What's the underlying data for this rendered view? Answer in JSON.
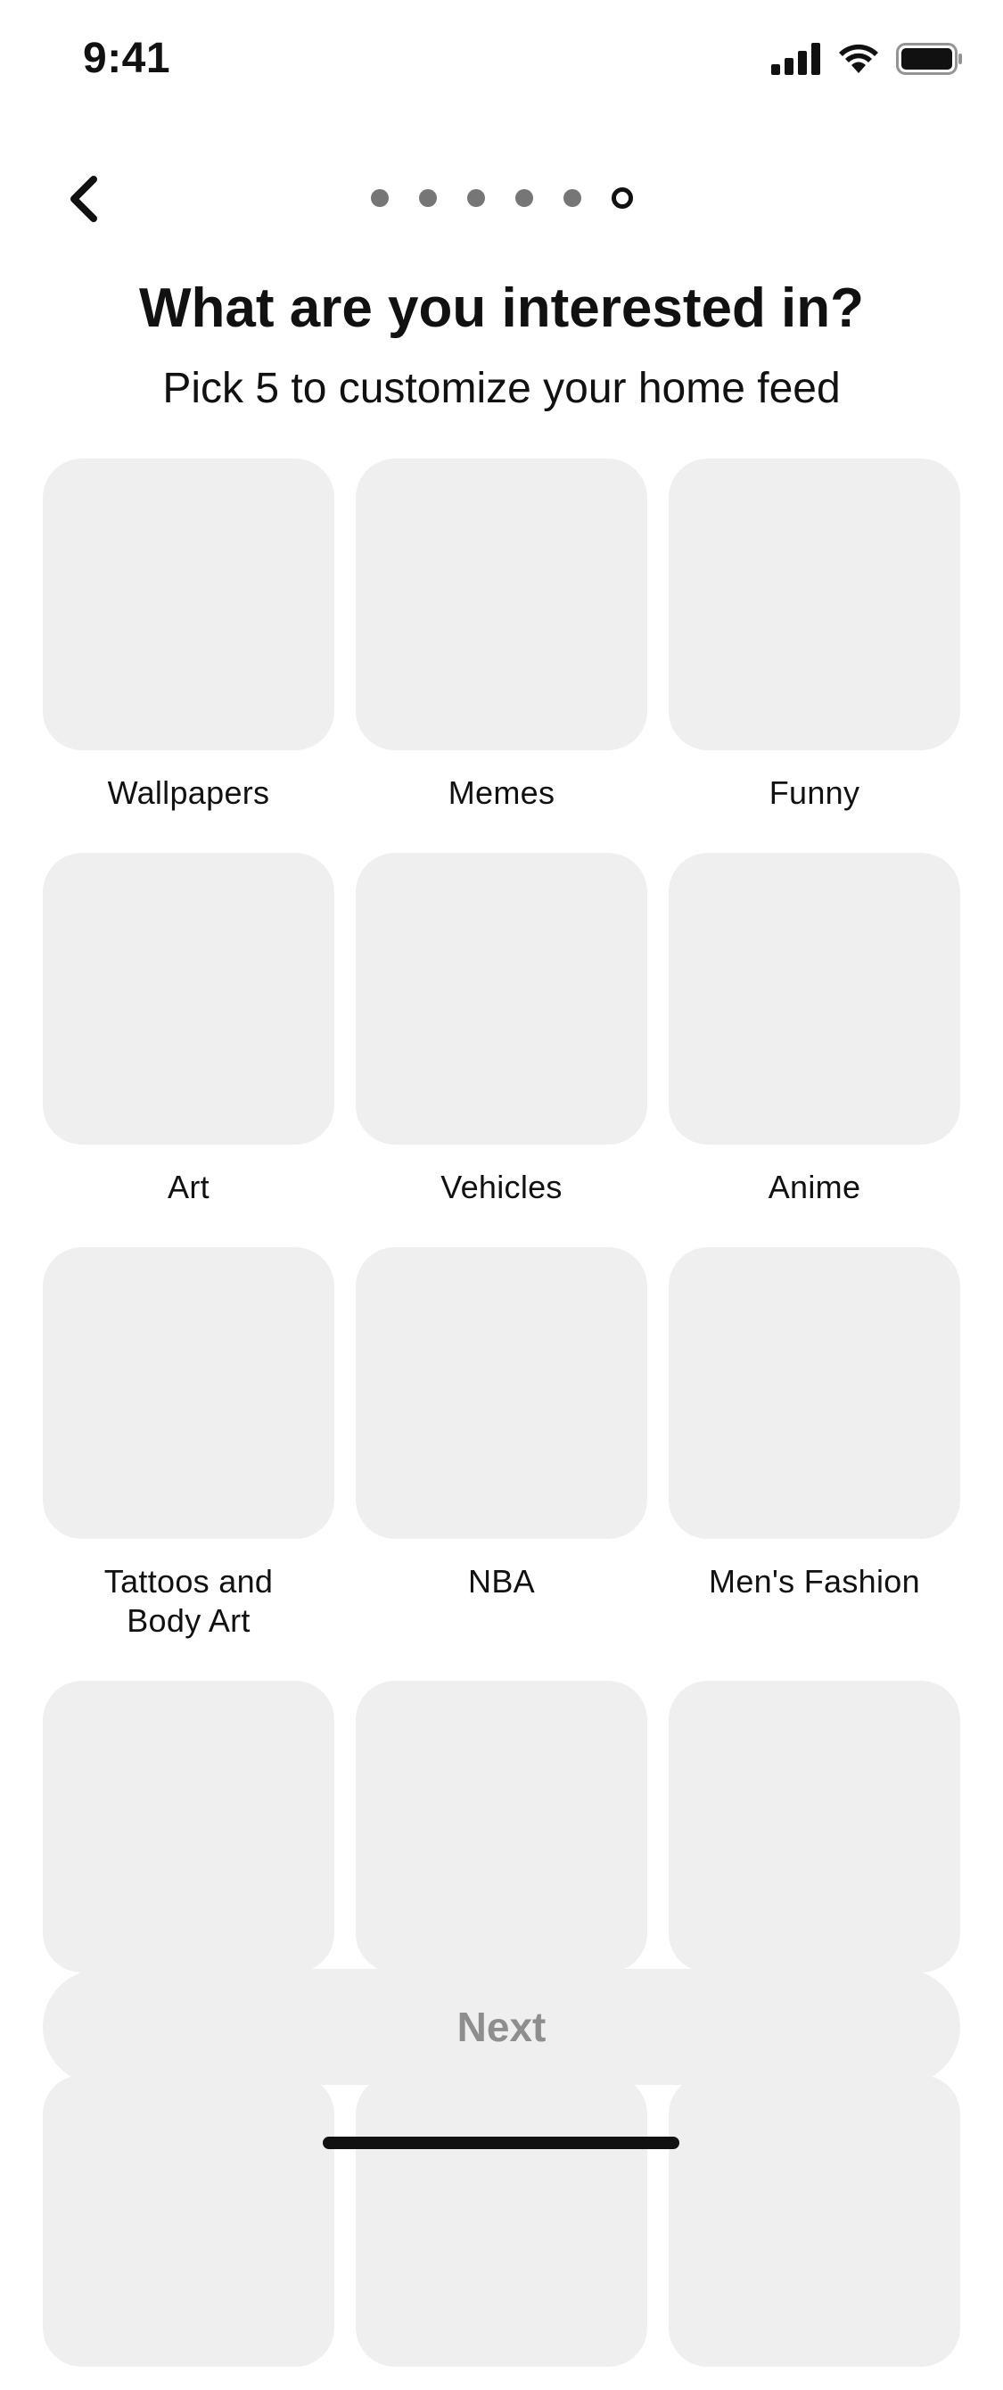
{
  "status_bar": {
    "time": "9:41",
    "icons": [
      "cellular-signal-icon",
      "wifi-icon",
      "battery-icon"
    ]
  },
  "header": {
    "back_icon": "chevron-left-icon",
    "progress": {
      "total_steps": 6,
      "current_step": 6
    }
  },
  "title": "What are you interested in?",
  "subtitle": "Pick 5 to customize your home feed",
  "interests": [
    {
      "label": "Wallpapers"
    },
    {
      "label": "Memes"
    },
    {
      "label": "Funny"
    },
    {
      "label": "Art"
    },
    {
      "label": "Vehicles"
    },
    {
      "label": "Anime"
    },
    {
      "label": "Tattoos and Body Art"
    },
    {
      "label": "NBA"
    },
    {
      "label": "Men's Fashion"
    },
    {
      "label": ""
    },
    {
      "label": ""
    },
    {
      "label": ""
    },
    {
      "label": ""
    },
    {
      "label": ""
    },
    {
      "label": ""
    }
  ],
  "next_button": {
    "label": "Next",
    "enabled": false
  },
  "colors": {
    "tile_background": "#efefef",
    "text_primary": "#111111",
    "dot_inactive": "#767676",
    "button_disabled_text": "#8e8e8e"
  }
}
